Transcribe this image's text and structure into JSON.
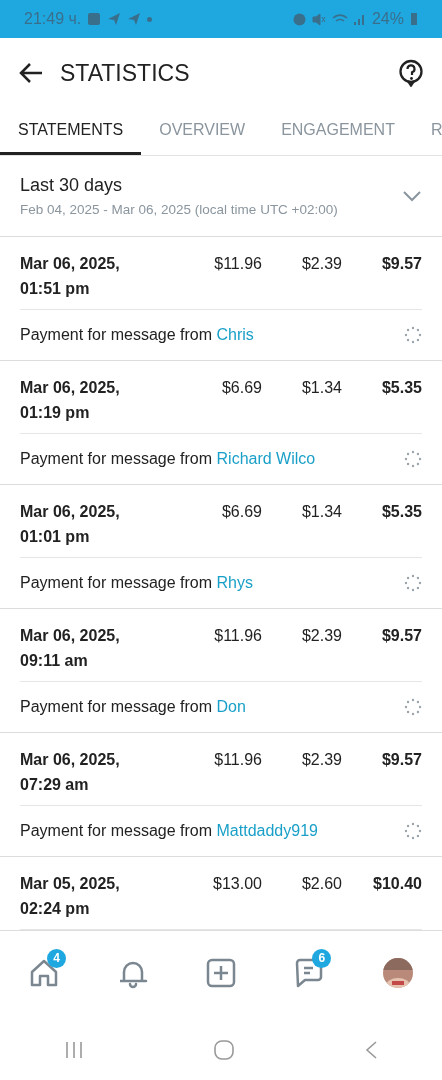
{
  "status_bar": {
    "time": "21:49 ч.",
    "battery": "24%"
  },
  "header": {
    "title": "STATISTICS"
  },
  "tabs": [
    {
      "label": "STATEMENTS",
      "selected": true
    },
    {
      "label": "OVERVIEW",
      "selected": false
    },
    {
      "label": "ENGAGEMENT",
      "selected": false
    },
    {
      "label": "R",
      "selected": false
    }
  ],
  "period": {
    "title": "Last 30 days",
    "range": "Feb 04, 2025 - Mar 06, 2025 (local time UTC +02:00)"
  },
  "statements": [
    {
      "date": "Mar 06, 2025,",
      "time": "01:51 pm",
      "gross": "$11.96",
      "fee": "$2.39",
      "net": "$9.57",
      "description": "Payment for message from",
      "user": "Chris"
    },
    {
      "date": "Mar 06, 2025,",
      "time": "01:19 pm",
      "gross": "$6.69",
      "fee": "$1.34",
      "net": "$5.35",
      "description": "Payment for message from",
      "user": "Richard Wilco"
    },
    {
      "date": "Mar 06, 2025,",
      "time": "01:01 pm",
      "gross": "$6.69",
      "fee": "$1.34",
      "net": "$5.35",
      "description": "Payment for message from",
      "user": "Rhys"
    },
    {
      "date": "Mar 06, 2025,",
      "time": "09:11 am",
      "gross": "$11.96",
      "fee": "$2.39",
      "net": "$9.57",
      "description": "Payment for message from",
      "user": "Don"
    },
    {
      "date": "Mar 06, 2025,",
      "time": "07:29 am",
      "gross": "$11.96",
      "fee": "$2.39",
      "net": "$9.57",
      "description": "Payment for message from",
      "user": "Mattdaddy919"
    },
    {
      "date": "Mar 05, 2025,",
      "time": "02:24 pm",
      "gross": "$13.00",
      "fee": "$2.60",
      "net": "$10.40"
    }
  ],
  "bottom_nav": [
    {
      "kind": "home",
      "badge": "4"
    },
    {
      "kind": "bell"
    },
    {
      "kind": "add"
    },
    {
      "kind": "chat",
      "badge": "6"
    },
    {
      "kind": "avatar"
    }
  ]
}
